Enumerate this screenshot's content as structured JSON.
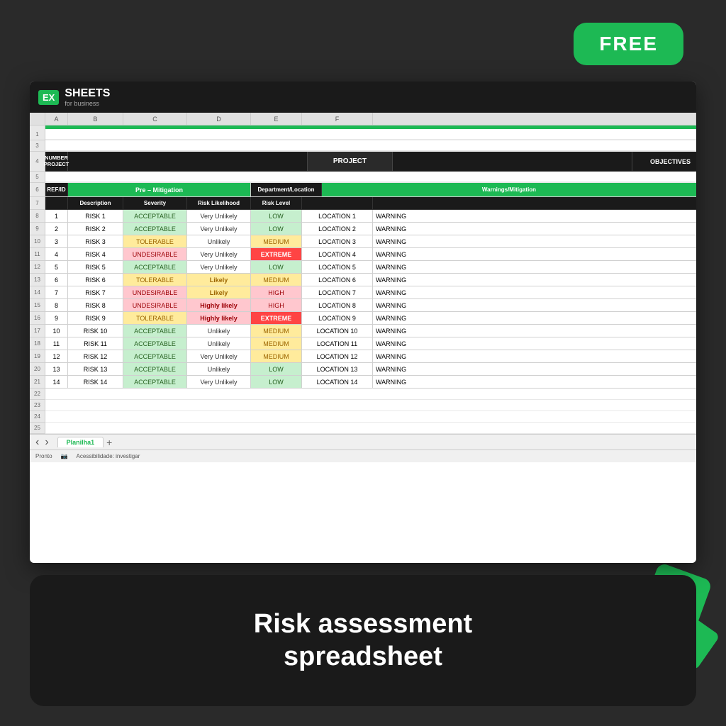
{
  "badge": {
    "free_label": "FREE"
  },
  "header": {
    "logo_ex": "EX",
    "logo_sheets": "SHEETS",
    "logo_sub": "for business"
  },
  "spreadsheet": {
    "col_headers": [
      "A",
      "B",
      "C",
      "D",
      "E",
      "F"
    ],
    "project_label": "NUMBER PROJECT",
    "project_center": "PROJECT",
    "project_right": "OBJECTIVES",
    "pre_mitigation": "Pre – Mitigation",
    "columns": {
      "ref_id": "REF/ID",
      "description": "Description",
      "severity": "Severity",
      "likelihood": "Risk Likelihood",
      "level": "Risk Level",
      "dept": "Department/Location",
      "warnings": "Warnings/Mitigation"
    },
    "rows": [
      {
        "num": "8",
        "id": "1",
        "risk": "RISK 1",
        "severity": "ACCEPTABLE",
        "sev_class": "sev-acceptable",
        "likelihood": "Very Unlikely",
        "lik_class": "lik-very-unlikely",
        "level": "LOW",
        "level_class": "level-low",
        "location": "LOCATION 1",
        "warning": "WARNING"
      },
      {
        "num": "9",
        "id": "2",
        "risk": "RISK 2",
        "severity": "ACCEPTABLE",
        "sev_class": "sev-acceptable",
        "likelihood": "Very Unlikely",
        "lik_class": "lik-very-unlikely",
        "level": "LOW",
        "level_class": "level-low",
        "location": "LOCATION 2",
        "warning": "WARNING"
      },
      {
        "num": "10",
        "id": "3",
        "risk": "RISK 3",
        "severity": "TOLERABLE",
        "sev_class": "sev-tolerable",
        "likelihood": "Unlikely",
        "lik_class": "lik-unlikely",
        "level": "MEDIUM",
        "level_class": "level-medium",
        "location": "LOCATION 3",
        "warning": "WARNING"
      },
      {
        "num": "11",
        "id": "4",
        "risk": "RISK 4",
        "severity": "UNDESIRABLE",
        "sev_class": "sev-undesirable",
        "likelihood": "Very Unlikely",
        "lik_class": "lik-very-unlikely",
        "level": "EXTREME",
        "level_class": "level-extreme",
        "location": "LOCATION 4",
        "warning": "WARNING"
      },
      {
        "num": "12",
        "id": "5",
        "risk": "RISK 5",
        "severity": "ACCEPTABLE",
        "sev_class": "sev-acceptable",
        "likelihood": "Very Unlikely",
        "lik_class": "lik-very-unlikely",
        "level": "LOW",
        "level_class": "level-low",
        "location": "LOCATION 5",
        "warning": "WARNING"
      },
      {
        "num": "13",
        "id": "6",
        "risk": "RISK 6",
        "severity": "TOLERABLE",
        "sev_class": "sev-tolerable",
        "likelihood": "Likely",
        "lik_class": "lik-likely",
        "level": "MEDIUM",
        "level_class": "level-medium",
        "location": "LOCATION 6",
        "warning": "WARNING"
      },
      {
        "num": "14",
        "id": "7",
        "risk": "RISK 7",
        "severity": "UNDESIRABLE",
        "sev_class": "sev-undesirable",
        "likelihood": "Likely",
        "lik_class": "lik-likely",
        "level": "HIGH",
        "level_class": "level-high",
        "location": "LOCATION 7",
        "warning": "WARNING"
      },
      {
        "num": "15",
        "id": "8",
        "risk": "RISK 8",
        "severity": "UNDESIRABLE",
        "sev_class": "sev-undesirable",
        "likelihood": "Highly likely",
        "lik_class": "lik-highly-likely",
        "level": "HIGH",
        "level_class": "level-high",
        "location": "LOCATION 8",
        "warning": "WARNING"
      },
      {
        "num": "16",
        "id": "9",
        "risk": "RISK 9",
        "severity": "TOLERABLE",
        "sev_class": "sev-tolerable",
        "likelihood": "Highly likely",
        "lik_class": "lik-highly-likely",
        "level": "EXTREME",
        "level_class": "level-extreme",
        "location": "LOCATION 9",
        "warning": "WARNING"
      },
      {
        "num": "17",
        "id": "10",
        "risk": "RISK 10",
        "severity": "ACCEPTABLE",
        "sev_class": "sev-acceptable",
        "likelihood": "Unlikely",
        "lik_class": "lik-unlikely",
        "level": "MEDIUM",
        "level_class": "level-medium",
        "location": "LOCATION 10",
        "warning": "WARNING"
      },
      {
        "num": "18",
        "id": "11",
        "risk": "RISK 11",
        "severity": "ACCEPTABLE",
        "sev_class": "sev-acceptable",
        "likelihood": "Unlikely",
        "lik_class": "lik-unlikely",
        "level": "MEDIUM",
        "level_class": "level-medium",
        "location": "LOCATION 11",
        "warning": "WARNING"
      },
      {
        "num": "19",
        "id": "12",
        "risk": "RISK 12",
        "severity": "ACCEPTABLE",
        "sev_class": "sev-acceptable",
        "likelihood": "Very Unlikely",
        "lik_class": "lik-very-unlikely",
        "level": "MEDIUM",
        "level_class": "level-medium",
        "location": "LOCATION 12",
        "warning": "WARNING"
      },
      {
        "num": "20",
        "id": "13",
        "risk": "RISK 13",
        "severity": "ACCEPTABLE",
        "sev_class": "sev-acceptable",
        "likelihood": "Unlikely",
        "lik_class": "lik-unlikely",
        "level": "LOW",
        "level_class": "level-low",
        "location": "LOCATION 13",
        "warning": "WARNING"
      },
      {
        "num": "21",
        "id": "14",
        "risk": "RISK 14",
        "severity": "ACCEPTABLE",
        "sev_class": "sev-acceptable",
        "likelihood": "Very Unlikely",
        "lik_class": "lik-very-unlikely",
        "level": "LOW",
        "level_class": "level-low",
        "location": "LOCATION 14",
        "warning": "WARNING"
      }
    ],
    "empty_rows": [
      "22",
      "23",
      "24",
      "25"
    ],
    "sheet_tab": "Planilha1",
    "status_ready": "Pronto",
    "status_accessibility": "Acessibilidade: investigar"
  },
  "bottom_text": {
    "line1": "Risk assessment",
    "line2": "spreadsheet"
  }
}
